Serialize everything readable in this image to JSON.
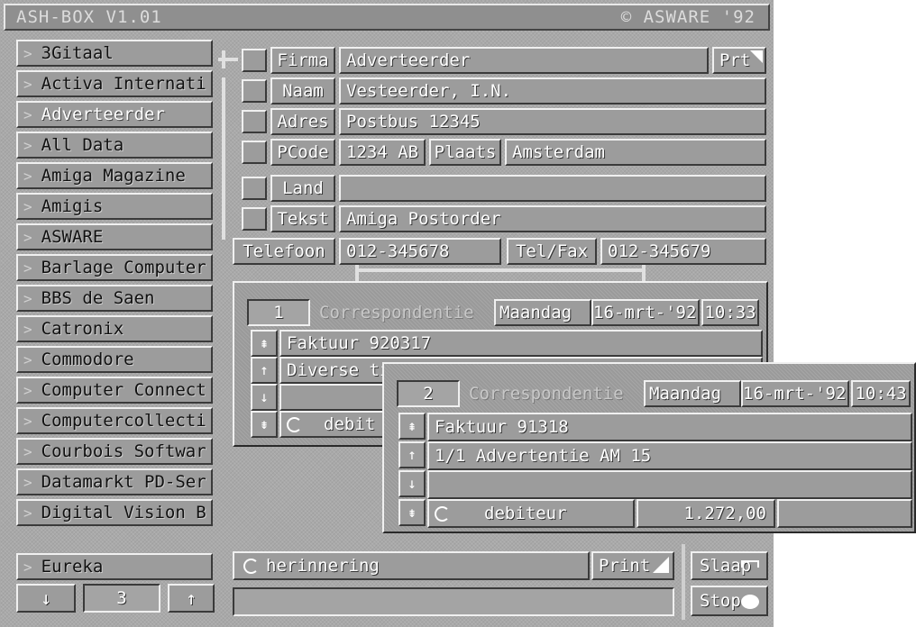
{
  "title_left": "ASH-BOX V1.01",
  "title_right": "© ASWARE '92",
  "companies": [
    "3Gitaal",
    "Activa Internati",
    "Adverteerder",
    "All Data",
    "Amiga Magazine",
    "Amigis",
    "ASWARE",
    "Barlage Computer",
    "BBS de Saen",
    "Catronix",
    "Commodore",
    "Computer Connect",
    "Computercollecti",
    "Courbois Softwar",
    "Datamarkt PD-Ser",
    "Digital Vision B",
    "Eureka"
  ],
  "selected_index": 2,
  "list_arrow": ">",
  "nav": {
    "down": "↓",
    "page": "3",
    "up": "↑"
  },
  "form": {
    "firma_label": "Firma",
    "firma": "Adverteerder",
    "prt": "Prt",
    "naam_label": "Naam",
    "naam": "Vesteerder, I.N.",
    "adres_label": "Adres",
    "adres": "Postbus 12345",
    "pcode_label": "PCode",
    "pcode": "1234 AB",
    "plaats_label": "Plaats",
    "plaats": "Amsterdam",
    "land_label": "Land",
    "land": "",
    "tekst_label": "Tekst",
    "tekst": "Amiga Postorder",
    "telefoon_label": "Telefoon",
    "telefoon": "012-345678",
    "telfax_label": "Tel/Fax",
    "telfax": "012-345679"
  },
  "corr1": {
    "number": "1",
    "title": "Correspondentie",
    "day": "Maandag",
    "date": "16-mrt-'92",
    "time": "10:33",
    "line1": "Faktuur 920317",
    "line2": "Diverse ti",
    "line3": "",
    "status": "debit"
  },
  "corr2": {
    "number": "2",
    "title": "Correspondentie",
    "day": "Maandag",
    "date": "16-mrt-'92",
    "time": "10:43",
    "line1": "Faktuur 91318",
    "line2": "1/1 Advertentie AM 15",
    "line3": "",
    "status": "debiteur",
    "amount": "1.272,00"
  },
  "side_icons": {
    "top": "⇞",
    "up": "↑",
    "down": "↓",
    "bottom": "⇟"
  },
  "bottom": {
    "herinnering": "herinnering",
    "print": "Print",
    "status_line": "",
    "slaap": "Slaap",
    "stop": "Stop"
  }
}
